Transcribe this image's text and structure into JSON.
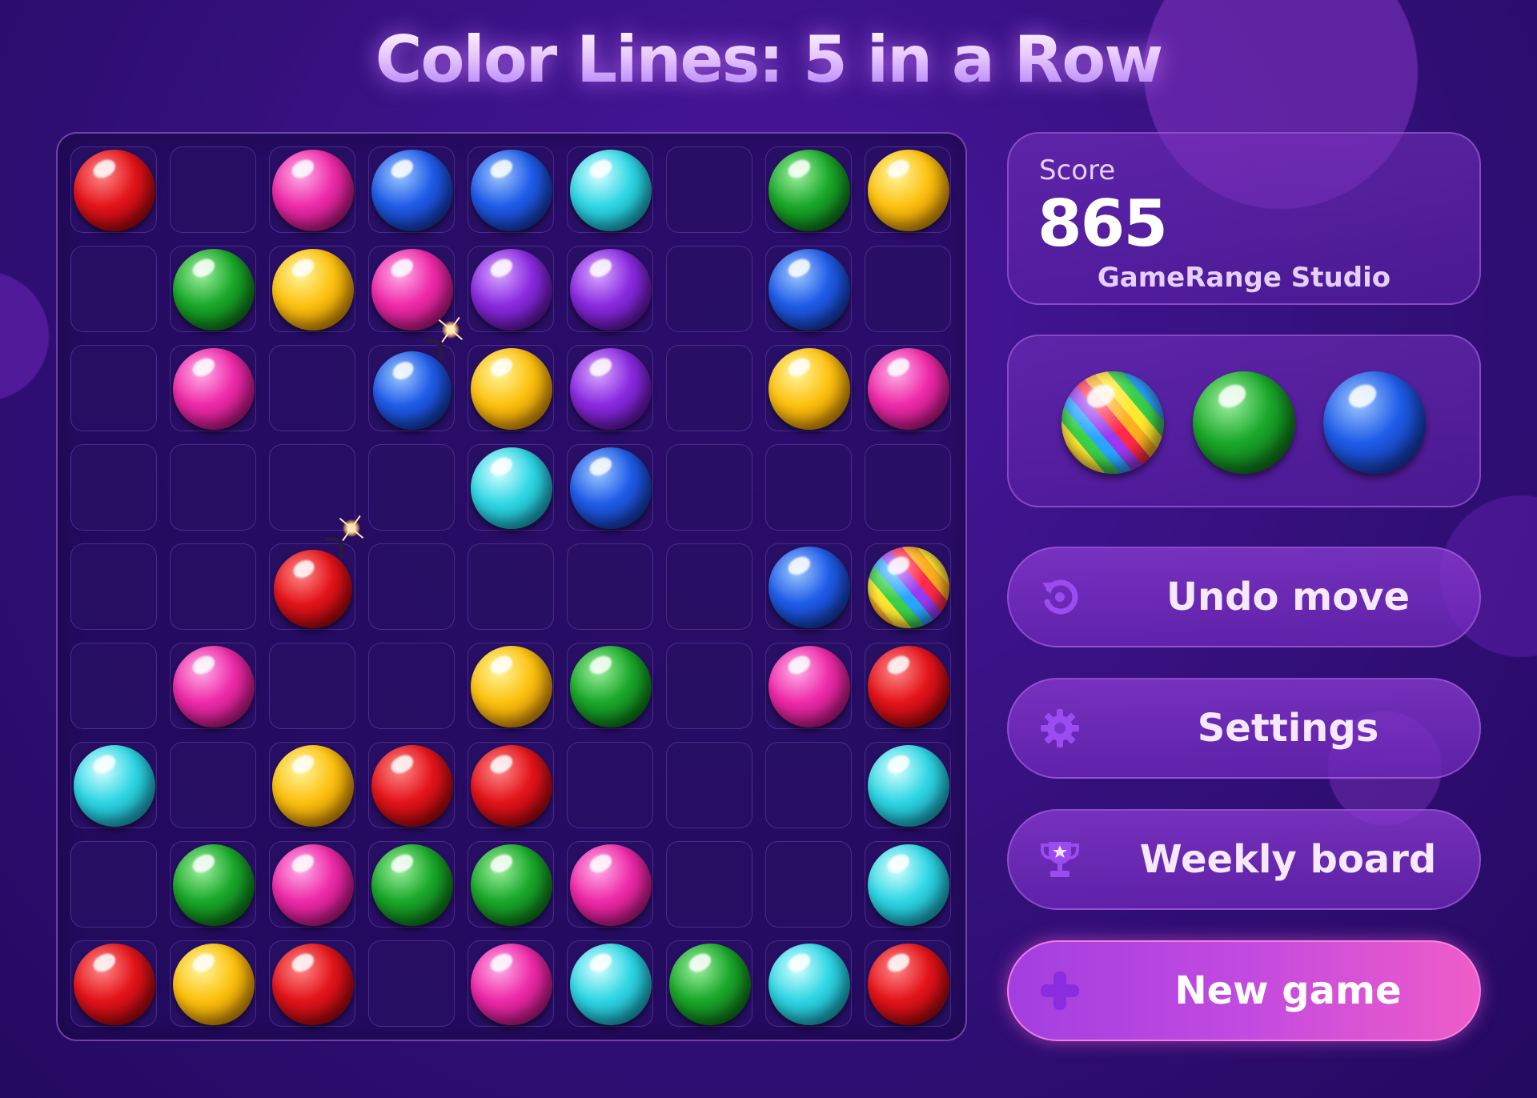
{
  "title": "Color Lines: 5 in a Row",
  "colors": {
    "red": [
      "#ff8a8a",
      "#e3141a",
      "#7a0006"
    ],
    "magenta": [
      "#ffb0e8",
      "#ee2aa8",
      "#8a0a60"
    ],
    "blue": [
      "#9fc8ff",
      "#1f5ce8",
      "#0a2380"
    ],
    "cyan": [
      "#d8ffff",
      "#2fd6e4",
      "#0a7f96"
    ],
    "yellow": [
      "#fff6a0",
      "#fcc10f",
      "#b06a00"
    ],
    "green": [
      "#9ff0a0",
      "#1aa82a",
      "#05500d"
    ],
    "purple": [
      "#d8a8ff",
      "#8a2ae0",
      "#40097a"
    ]
  },
  "board": {
    "rows": [
      [
        "red",
        "",
        "magenta",
        "blue",
        "blue",
        "cyan",
        "",
        "green",
        "yellow"
      ],
      [
        "",
        "green",
        "yellow",
        "magenta",
        "purple",
        "purple",
        "",
        "blue",
        ""
      ],
      [
        "",
        "magenta",
        "",
        "bomb-blue",
        "yellow",
        "purple",
        "",
        "yellow",
        "magenta"
      ],
      [
        "",
        "",
        "",
        "",
        "cyan",
        "blue",
        "",
        "",
        ""
      ],
      [
        "",
        "",
        "bomb-red",
        "",
        "",
        "",
        "",
        "blue",
        "rainbow"
      ],
      [
        "",
        "magenta",
        "",
        "",
        "yellow",
        "green",
        "",
        "magenta",
        "red"
      ],
      [
        "cyan",
        "",
        "yellow",
        "red",
        "red",
        "",
        "",
        "",
        "cyan"
      ],
      [
        "",
        "green",
        "magenta",
        "green",
        "green",
        "magenta",
        "",
        "",
        "cyan"
      ],
      [
        "red",
        "yellow",
        "red",
        "",
        "magenta",
        "cyan",
        "green",
        "cyan",
        "red"
      ]
    ]
  },
  "score": {
    "label": "Score",
    "value": "865",
    "studio": "GameRange Studio"
  },
  "next_balls": [
    "rainbow",
    "green",
    "blue"
  ],
  "buttons": {
    "undo": {
      "label": "Undo move",
      "icon": "undo-icon"
    },
    "settings": {
      "label": "Settings",
      "icon": "gear-icon"
    },
    "weekly": {
      "label": "Weekly board",
      "icon": "trophy-icon"
    },
    "new_game": {
      "label": "New game",
      "icon": "plus-icon"
    }
  }
}
